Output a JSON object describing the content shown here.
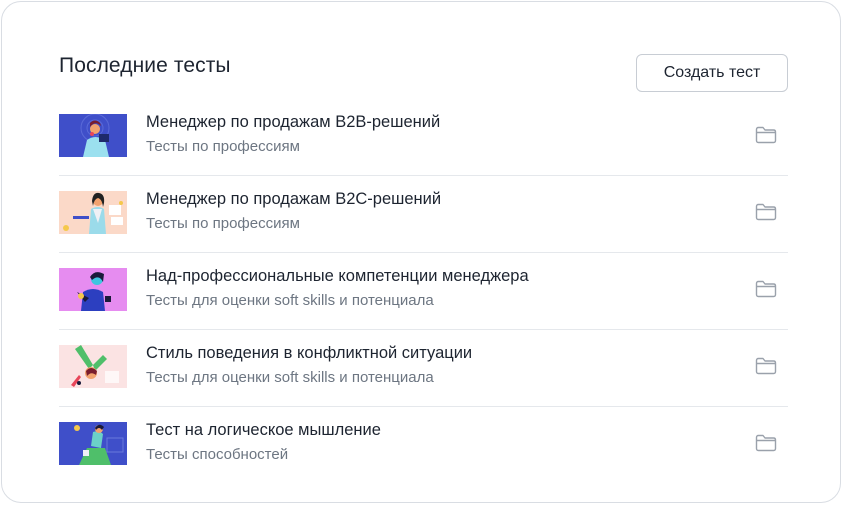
{
  "section": {
    "title": "Последние тесты",
    "create_label": "Создать тест"
  },
  "tests": [
    {
      "title": "Менеджер по продажам B2B-решений",
      "category": "Тесты по профессиям",
      "thumb_bg": "#3f4fc9"
    },
    {
      "title": "Менеджер по продажам B2C-решений",
      "category": "Тесты по профессиям",
      "thumb_bg": "#fbd9c8"
    },
    {
      "title": "Над-профессиональные компетенции менеджера",
      "category": "Тесты для оценки soft skills и потенциала",
      "thumb_bg": "#e68cf0"
    },
    {
      "title": "Стиль поведения в конфликтной ситуации",
      "category": "Тесты для оценки soft skills и потенциала",
      "thumb_bg": "#fbe3e3"
    },
    {
      "title": "Тест на логическое мышление",
      "category": "Тесты способностей",
      "thumb_bg": "#3f4fc9"
    }
  ],
  "icons": {
    "folder": "folder-icon",
    "thumbnail": "illustration"
  },
  "colors": {
    "text_primary": "#1d2430",
    "text_secondary": "#6d7682",
    "border": "#d9dde3",
    "icon": "#9aa1ab"
  }
}
